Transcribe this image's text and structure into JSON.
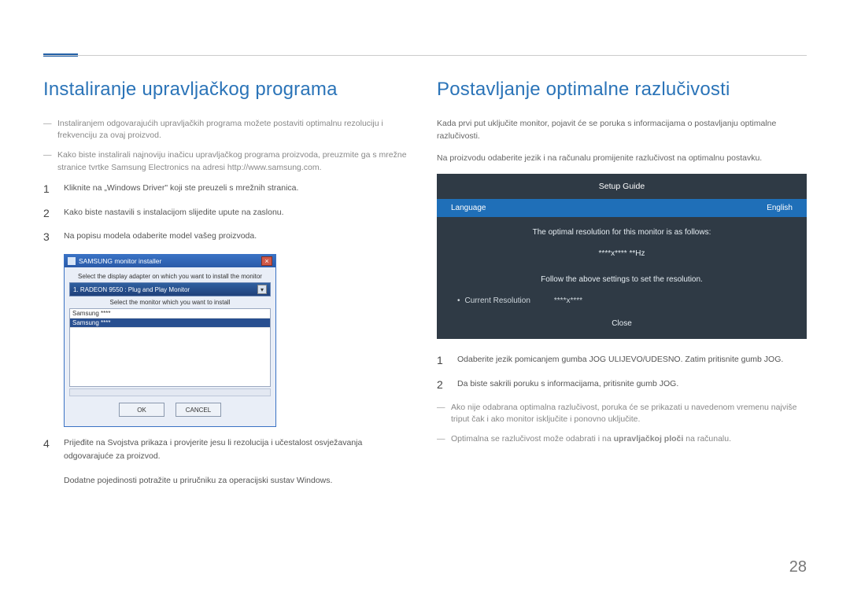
{
  "page_number": "28",
  "left": {
    "heading": "Instaliranje upravljačkog programa",
    "dash1": "Instaliranjem odgovarajućih upravljačkih programa možete postaviti optimalnu rezoluciju i frekvenciju za ovaj proizvod.",
    "dash2": "Kako biste instalirali najnoviju inačicu upravljačkog programa proizvoda, preuzmite ga s mrežne stranice tvrtke Samsung Electronics na adresi http://www.samsung.com.",
    "step1": "Kliknite na „Windows Driver\" koji ste preuzeli s mrežnih stranica.",
    "step2": "Kako biste nastavili s instalacijom slijedite upute na zaslonu.",
    "step3": "Na popisu modela odaberite model vašeg proizvoda.",
    "step4": "Prijeđite na Svojstva prikaza i provjerite jesu li rezolucija i učestalost osvježavanja odgovarajuće za proizvod.",
    "step4_sub": "Dodatne pojedinosti potražite u priručniku za operacijski sustav Windows.",
    "installer": {
      "title": "SAMSUNG monitor installer",
      "line1": "Select the display adapter on which you want to install the monitor",
      "adapter": "1. RADEON 9550 : Plug and Play Monitor",
      "line2": "Select the monitor which you want to install",
      "row1": "Samsung ****",
      "row2": "Samsung ****",
      "ok": "OK",
      "cancel": "CANCEL"
    }
  },
  "right": {
    "heading": "Postavljanje optimalne razlučivosti",
    "intro1": "Kada prvi put uključite monitor, pojavit će se poruka s informacijama o postavljanju optimalne razlučivosti.",
    "intro2": "Na proizvodu odaberite jezik i na računalu promijenite razlučivost na optimalnu postavku.",
    "osd": {
      "title": "Setup Guide",
      "lang_label": "Language",
      "lang_value": "English",
      "msg": "The optimal resolution for this monitor is as follows:",
      "res": "****x**** **Hz",
      "follow": "Follow the above settings to set the resolution.",
      "cur_label": "Current Resolution",
      "cur_value": "****x****",
      "close": "Close"
    },
    "step1": "Odaberite jezik pomicanjem gumba JOG ULIJEVO/UDESNO. Zatim pritisnite gumb JOG.",
    "step2": "Da biste sakrili poruku s informacijama, pritisnite gumb JOG.",
    "dash3": "Ako nije odabrana optimalna razlučivost, poruka će se prikazati u navedenom vremenu najviše triput čak i ako monitor isključite i ponovno uključite.",
    "dash4_a": "Optimalna se razlučivost može odabrati i na ",
    "dash4_b": "upravljačkoj ploči",
    "dash4_c": " na računalu."
  }
}
